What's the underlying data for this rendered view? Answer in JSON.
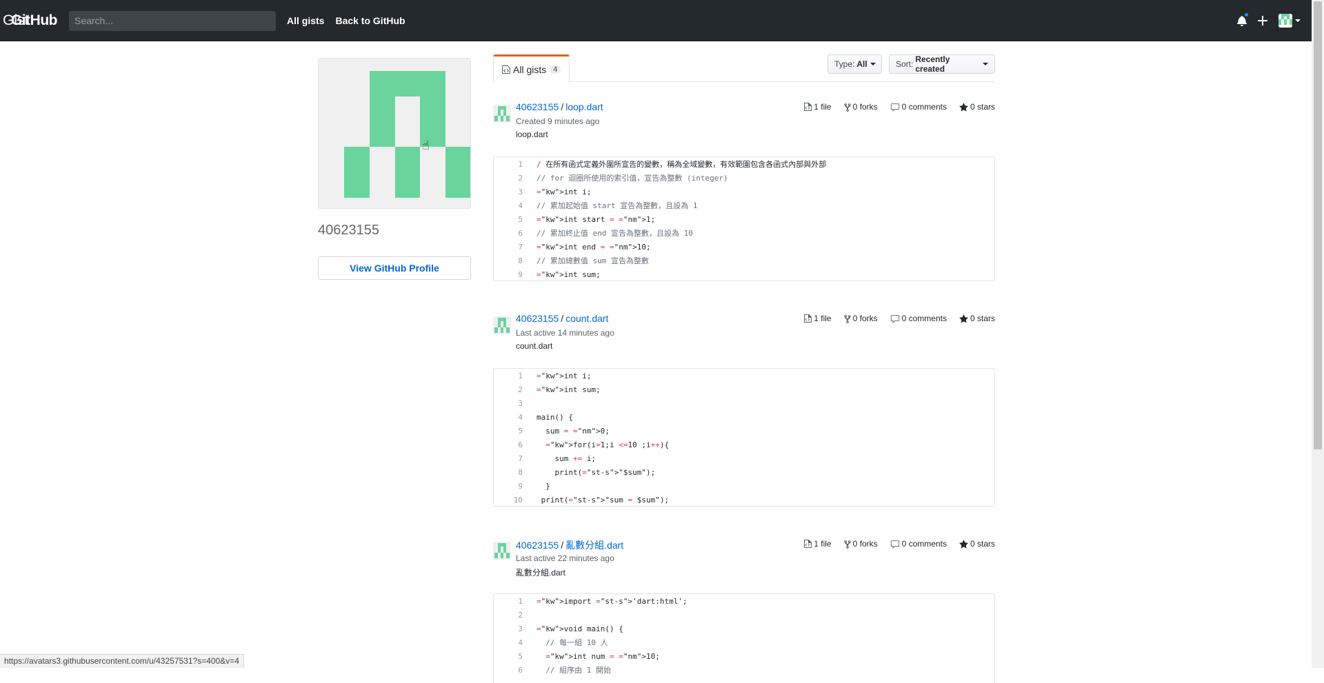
{
  "header": {
    "logo_brand": "GitHub",
    "logo_product": "Gist",
    "search_placeholder": "Search...",
    "nav_all_gists": "All gists",
    "nav_back": "Back to GitHub"
  },
  "sidebar": {
    "username": "40623155",
    "profile_button": "View GitHub Profile"
  },
  "tabs": {
    "all_gists_label": "All gists",
    "all_gists_count": "4"
  },
  "filters": {
    "type_label": "Type:",
    "type_value": "All",
    "sort_label": "Sort:",
    "sort_value": "Recently created"
  },
  "gists": [
    {
      "owner": "40623155",
      "filename": "loop.dart",
      "meta": "Created 9 minutes ago",
      "description": "loop.dart",
      "files": "1 file",
      "forks": "0 forks",
      "comments": "0 comments",
      "stars": "0 stars",
      "lines": [
        "/ 在所有函式定義外圍所宣告的變數，稱為全域變數，有效範圍包含各函式內部與外部",
        "// for 迴圈所使用的索引值，宣告為整數 (integer)",
        "int i;",
        "// 累加起始值 start 宣告為整數，且設為 1",
        "int start = 1;",
        "// 累加終止值 end 宣告為整數，且設為 10",
        "int end = 10;",
        "// 累加總數值 sum 宣告為整數",
        "int sum;"
      ]
    },
    {
      "owner": "40623155",
      "filename": "count.dart",
      "meta": "Last active 14 minutes ago",
      "description": "count.dart",
      "files": "1 file",
      "forks": "0 forks",
      "comments": "0 comments",
      "stars": "0 stars",
      "lines": [
        "int i;",
        "int sum;",
        "",
        "main() {",
        "  sum = 0;",
        "  for(i=1;i <=10 ;i++){",
        "    sum += i;",
        "    print(\"$sum\");",
        "  }",
        " print(\"sum = $sum\");"
      ]
    },
    {
      "owner": "40623155",
      "filename": "亂數分組.dart",
      "meta": "Last active 22 minutes ago",
      "description": "亂數分組.dart",
      "files": "1 file",
      "forks": "0 forks",
      "comments": "0 comments",
      "stars": "0 stars",
      "lines": [
        "import 'dart:html';",
        "",
        "void main() {",
        "  // 每一組 10 人",
        "  int num = 10;",
        "  // 組序由 1 開始"
      ]
    }
  ],
  "status_bar": "https://avatars3.githubusercontent.com/u/43257531?s=400&v=4",
  "colors": {
    "header_bg": "#24292e",
    "identicon": "#6bd49e",
    "link": "#0366d6",
    "tab_accent": "#e36209"
  }
}
